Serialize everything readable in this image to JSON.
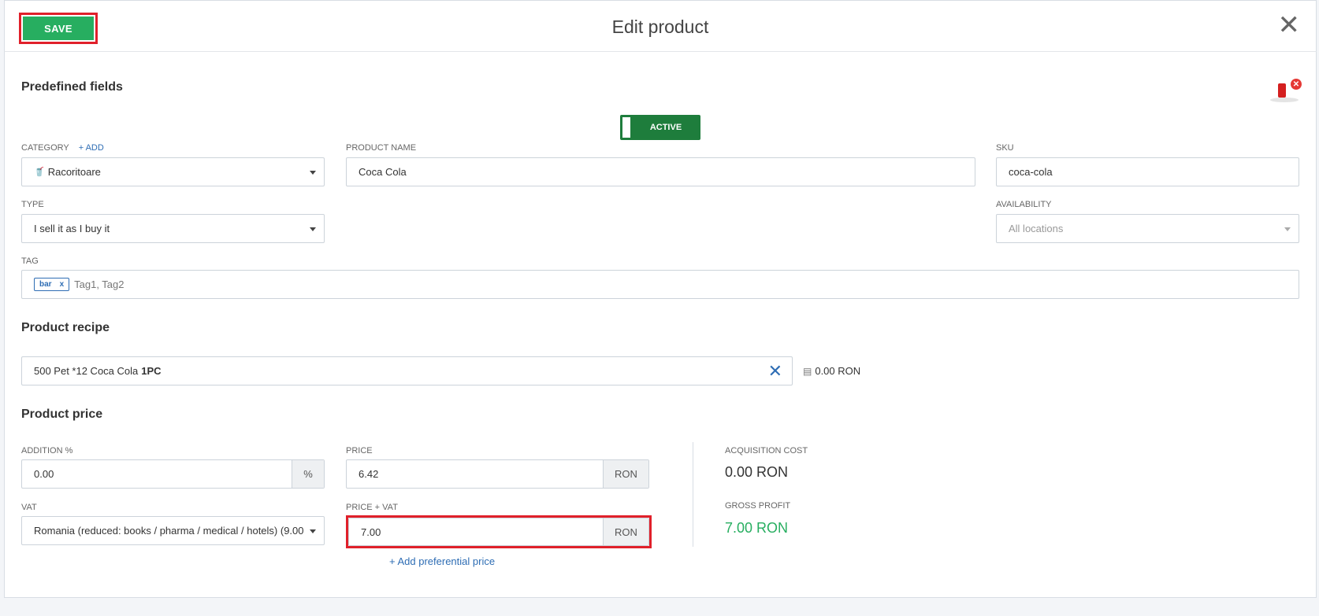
{
  "header": {
    "save_label": "SAVE",
    "title": "Edit product",
    "close_glyph": "✕"
  },
  "predefined": {
    "title": "Predefined fields",
    "status_label": "ACTIVE",
    "category_label": "CATEGORY",
    "category_add": "+ ADD",
    "category_value": "Racoritoare",
    "category_icon": "drink-icon",
    "product_name_label": "PRODUCT NAME",
    "product_name_value": "Coca Cola",
    "sku_label": "SKU",
    "sku_value": "coca-cola",
    "type_label": "TYPE",
    "type_value": "I sell it as I buy it",
    "availability_label": "AVAILABILITY",
    "availability_placeholder": "All locations",
    "tag_label": "TAG",
    "tags": [
      "bar"
    ],
    "tag_remove": "x",
    "tag_placeholder": "Tag1, Tag2"
  },
  "recipe": {
    "title": "Product recipe",
    "item_text": "500 Pet *12 Coca Cola",
    "item_qty": "1PC",
    "cost": "0.00 RON"
  },
  "price": {
    "title": "Product price",
    "addition_label": "ADDITION %",
    "addition_value": "0.00",
    "addition_unit": "%",
    "price_label": "PRICE",
    "price_value": "6.42",
    "price_unit": "RON",
    "vat_label": "VAT",
    "vat_value": "Romania (reduced: books / pharma / medical / hotels) (9.00",
    "price_vat_label": "PRICE + VAT",
    "price_vat_value": "7.00",
    "price_vat_unit": "RON",
    "add_preferential": "+ Add preferential price",
    "acquisition_label": "ACQUISITION COST",
    "acquisition_value": "0.00 RON",
    "gross_profit_label": "GROSS PROFIT",
    "gross_profit_value": "7.00 RON"
  },
  "colors": {
    "save_green": "#27ae60",
    "active_green": "#1e7d3c",
    "highlight_red": "#e0202a",
    "link_blue": "#2e6db4",
    "profit_green": "#27ae60"
  }
}
